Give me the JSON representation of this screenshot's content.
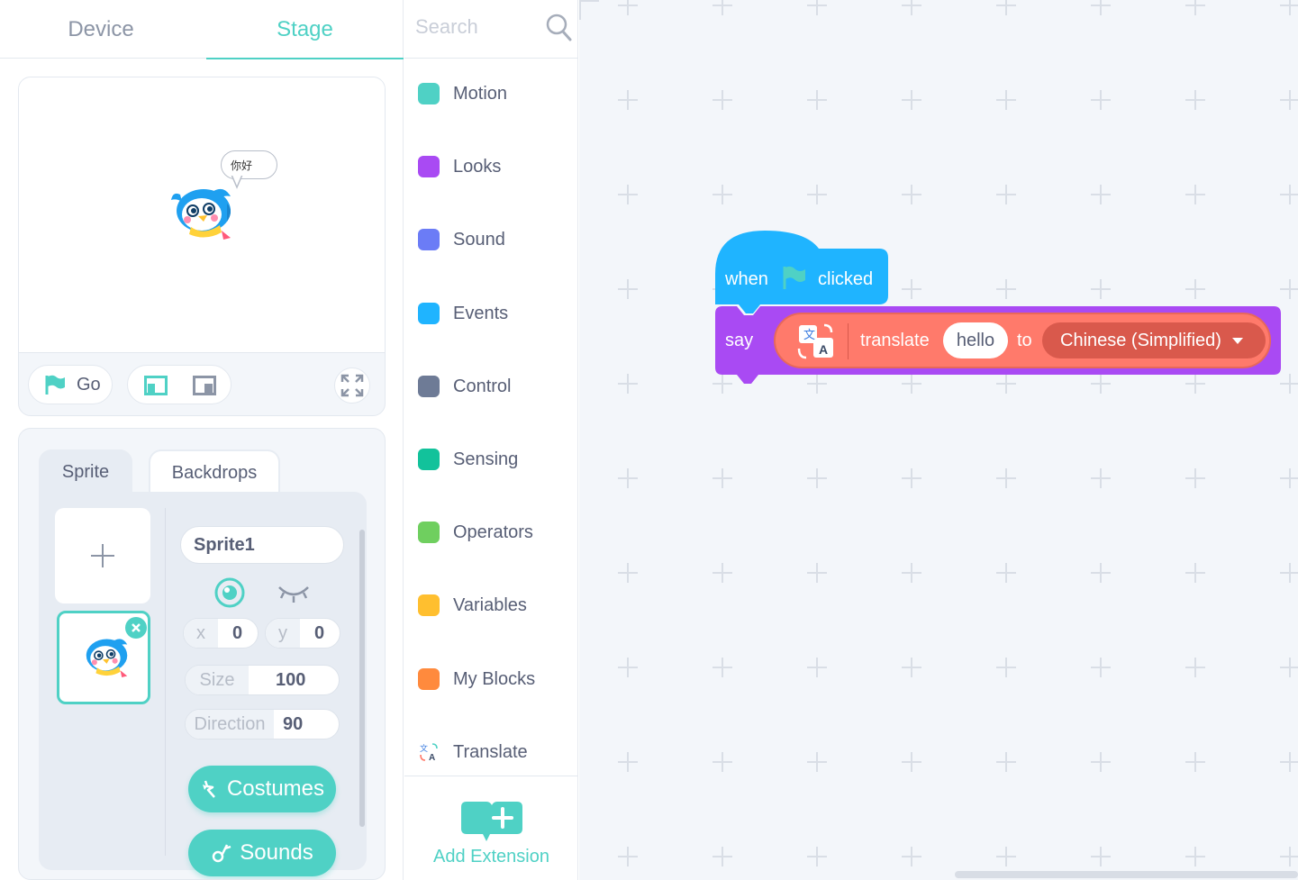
{
  "tabs": {
    "device": "Device",
    "stage": "Stage"
  },
  "stage": {
    "bubble_text": "你好",
    "go_label": "Go"
  },
  "sprite_panel": {
    "tab_sprite": "Sprite",
    "tab_backdrops": "Backdrops",
    "sprite_name": "Sprite1",
    "x_label": "x",
    "x_value": "0",
    "y_label": "y",
    "y_value": "0",
    "size_label": "Size",
    "size_value": "100",
    "direction_label": "Direction",
    "direction_value": "90",
    "costumes_label": "Costumes",
    "sounds_label": "Sounds"
  },
  "palette": {
    "search_placeholder": "Search",
    "categories": [
      {
        "label": "Motion",
        "color": "#4fd1c5"
      },
      {
        "label": "Looks",
        "color": "#a94af3"
      },
      {
        "label": "Sound",
        "color": "#6b7cf6"
      },
      {
        "label": "Events",
        "color": "#1fb4ff"
      },
      {
        "label": "Control",
        "color": "#6e7b96"
      },
      {
        "label": "Sensing",
        "color": "#12c29b"
      },
      {
        "label": "Operators",
        "color": "#6fcf5f"
      },
      {
        "label": "Variables",
        "color": "#ffbf2f"
      },
      {
        "label": "My Blocks",
        "color": "#ff8a3d"
      },
      {
        "label": "Translate",
        "color": "translate-icon"
      }
    ],
    "add_extension_label": "Add Extension"
  },
  "script": {
    "hat_when": "when",
    "hat_clicked": "clicked",
    "say": "say",
    "translate": "translate",
    "input_text": "hello",
    "to": "to",
    "language": "Chinese (Simplified)",
    "colors": {
      "events": "#1fb4ff",
      "looks": "#a94af3",
      "translate": "#ff7a6b"
    }
  }
}
